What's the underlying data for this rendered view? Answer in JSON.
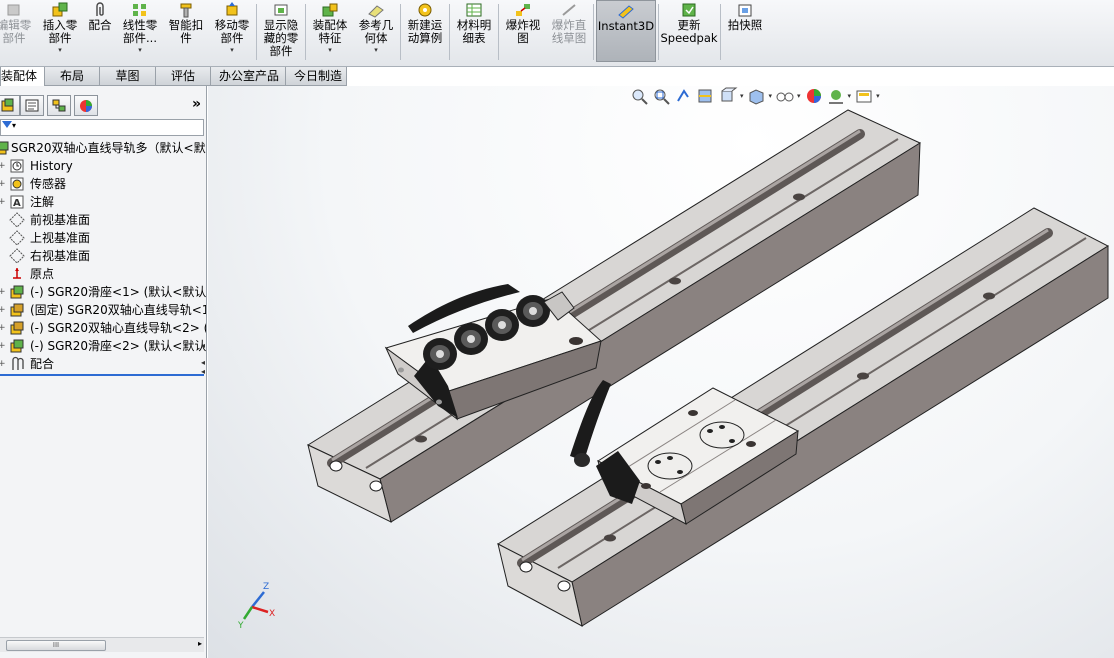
{
  "toolbar": {
    "buttons": [
      {
        "label": "编辑零\n部件",
        "disabled": true,
        "arrow": false
      },
      {
        "label": "插入零\n部件",
        "disabled": false,
        "arrow": true
      },
      {
        "label": "配合",
        "disabled": false,
        "arrow": false
      },
      {
        "label": "线性零\n部件...",
        "disabled": false,
        "arrow": true
      },
      {
        "label": "智能扣\n件",
        "disabled": false,
        "arrow": false
      },
      {
        "label": "移动零\n部件",
        "disabled": false,
        "arrow": true
      },
      {
        "label": "显示隐\n藏的零\n部件",
        "disabled": false,
        "arrow": false
      },
      {
        "label": "装配体\n特征",
        "disabled": false,
        "arrow": true
      },
      {
        "label": "参考几\n何体",
        "disabled": false,
        "arrow": true
      },
      {
        "label": "新建运\n动算例",
        "disabled": false,
        "arrow": false
      },
      {
        "label": "材料明\n细表",
        "disabled": false,
        "arrow": false
      },
      {
        "label": "爆炸视\n图",
        "disabled": false,
        "arrow": false
      },
      {
        "label": "爆炸直\n线草图",
        "disabled": true,
        "arrow": false
      },
      {
        "label": "Instant3D",
        "disabled": false,
        "arrow": false
      },
      {
        "label": "更新\nSpeedpak",
        "disabled": false,
        "arrow": false
      },
      {
        "label": "拍快照",
        "disabled": false,
        "arrow": false
      }
    ]
  },
  "tabs": [
    "装配体",
    "布局",
    "草图",
    "评估",
    "办公室产品",
    "今日制造"
  ],
  "active_tab": "装配体",
  "feature_tree": {
    "more_symbol": "»",
    "root": "SGR20双轴心直线导轨多（默认<默认",
    "items": [
      {
        "label": "History",
        "icon": "history-icon"
      },
      {
        "label": "传感器",
        "icon": "sensor-icon"
      },
      {
        "label": "注解",
        "icon": "annotation-icon"
      },
      {
        "label": "前视基准面",
        "icon": "plane-icon"
      },
      {
        "label": "上视基准面",
        "icon": "plane-icon"
      },
      {
        "label": "右视基准面",
        "icon": "plane-icon"
      },
      {
        "label": "原点",
        "icon": "origin-icon"
      },
      {
        "label": "(-) SGR20滑座<1> (默认<默认_",
        "icon": "part-icon"
      },
      {
        "label": "(固定) SGR20双轴心直线导轨<1",
        "icon": "part-icon"
      },
      {
        "label": "(-) SGR20双轴心直线导轨<2> (默",
        "icon": "part-icon"
      },
      {
        "label": "(-) SGR20滑座<2> (默认<默认_",
        "icon": "part-icon"
      },
      {
        "label": "配合",
        "icon": "mates-icon"
      }
    ],
    "scroll_thumb": "III"
  },
  "triad": {
    "x": "X",
    "y": "Y",
    "z": "Z"
  },
  "colors": {
    "accent": "#2d6bd3",
    "rail_top": "#d9d6d4",
    "rail_side": "#7f7775",
    "handle": "#1b1b1b"
  }
}
